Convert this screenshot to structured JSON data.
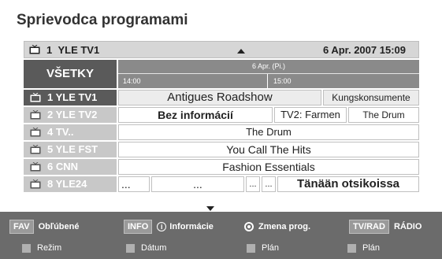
{
  "title": "Sprievodca programami",
  "header": {
    "channel_number": "1",
    "channel_name": "YLE TV1",
    "datetime": "6 Apr. 2007 15:09"
  },
  "filter_label": "VŠETKY",
  "timeline": {
    "date": "6 Apr. (Pi.)",
    "times": [
      "14:00",
      "15:00"
    ]
  },
  "rows": [
    {
      "number": "1",
      "name": "YLE TV1",
      "active": true,
      "programs": [
        "Antigues Roadshow",
        "Kungskonsumente"
      ]
    },
    {
      "number": "2",
      "name": "YLE TV2",
      "active": false,
      "programs": [
        "Bez informácií",
        "TV2: Farmen",
        "The Drum"
      ]
    },
    {
      "number": "4",
      "name": "TV..",
      "active": false,
      "programs": [
        "The Drum"
      ]
    },
    {
      "number": "5",
      "name": "YLE FST",
      "active": false,
      "programs": [
        "You Call The Hits"
      ]
    },
    {
      "number": "6",
      "name": "CNN",
      "active": false,
      "programs": [
        "Fashion Essentials"
      ]
    },
    {
      "number": "8",
      "name": "YLE24",
      "active": false,
      "programs": [
        "...",
        "...",
        "...",
        "...",
        "Tänään otsikoissa"
      ]
    }
  ],
  "legend": {
    "fav_key": "FAV",
    "fav_label": "Obľúbené",
    "info_key": "INFO",
    "info_label": "Informácie",
    "zmena_label": "Zmena prog.",
    "tvrad_key": "TV/RAD",
    "radio_label": "RÁDIO",
    "color_items": [
      "Režim",
      "Dátum",
      "Plán",
      "Plán"
    ]
  },
  "icons": {
    "tv": "tv-set-icon",
    "up": "up-arrow-icon",
    "down": "down-arrow-icon",
    "info": "info-icon",
    "radio": "ok-radio-icon"
  }
}
